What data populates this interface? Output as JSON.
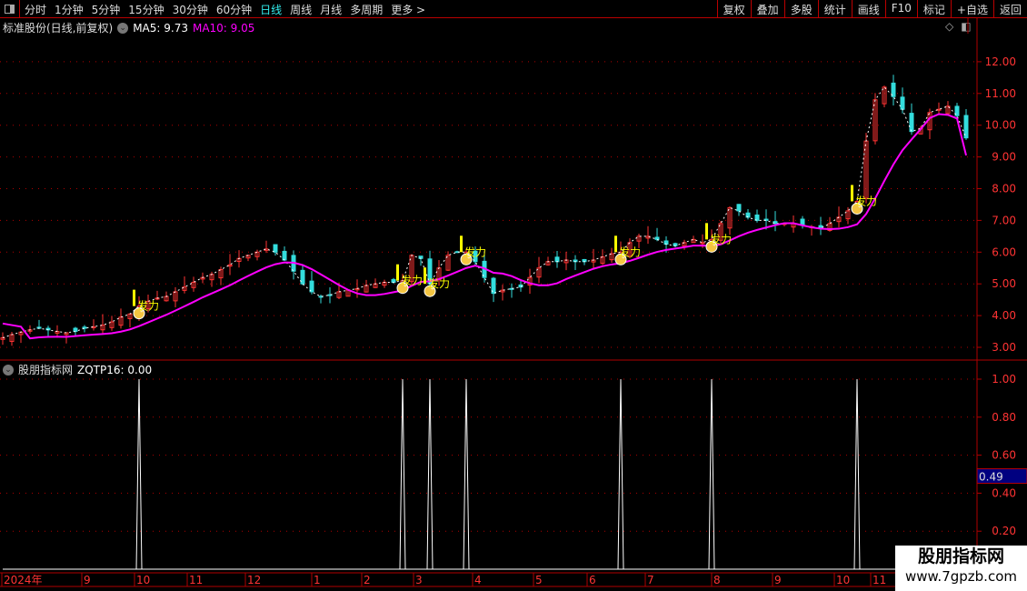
{
  "toolbar": {
    "periods": [
      "分时",
      "1分钟",
      "5分钟",
      "15分钟",
      "30分钟",
      "60分钟",
      "日线",
      "周线",
      "月线",
      "多周期",
      "更多 >"
    ],
    "active_period": "日线",
    "tools": [
      "复权",
      "叠加",
      "多股",
      "统计",
      "画线",
      "F10",
      "标记",
      "+自选",
      "返回"
    ]
  },
  "main_panel": {
    "title": "标准股份(日线,前复权)",
    "ma5_label": "MA5: 9.73",
    "ma10_label": "MA10: 9.05",
    "signal_text": "发力",
    "colors": {
      "up": "#ff3333",
      "down": "#33dddd",
      "ma10": "#ff00ff",
      "signal": "#ffff00",
      "grid": "#b00000"
    }
  },
  "indicator_panel": {
    "title": "股朋指标网",
    "value_label": "ZQTP16: 0.00",
    "cursor_value": "0.49"
  },
  "chart_data": [
    {
      "type": "candlestick",
      "ylim": [
        2.7,
        12.9
      ],
      "y_ticks": [
        "3.00",
        "4.00",
        "5.00",
        "6.00",
        "7.00",
        "8.00",
        "9.00",
        "10.00",
        "11.00",
        "12.00"
      ],
      "x_ticks": [
        "2024年",
        "9",
        "10",
        "11",
        "12",
        "1",
        "2",
        "3",
        "4",
        "5",
        "6",
        "7",
        "8",
        "9",
        "10",
        "11"
      ],
      "closes": [
        3.3,
        3.4,
        3.48,
        3.55,
        3.6,
        3.55,
        3.5,
        3.46,
        3.5,
        3.6,
        3.65,
        3.7,
        3.8,
        3.95,
        4.05,
        4.3,
        4.45,
        4.55,
        4.6,
        4.75,
        4.9,
        5.05,
        5.2,
        5.3,
        5.45,
        5.6,
        5.8,
        5.9,
        6.0,
        6.1,
        6.0,
        5.75,
        5.4,
        5.0,
        4.75,
        4.6,
        4.65,
        4.75,
        4.8,
        4.85,
        4.95,
        5.0,
        5.05,
        5.05,
        5.1,
        5.9,
        5.8,
        5.0,
        5.5,
        5.9,
        6.0,
        6.0,
        5.7,
        5.2,
        4.7,
        4.8,
        4.85,
        4.9,
        5.2,
        5.5,
        5.7,
        5.7,
        5.75,
        5.7,
        5.7,
        5.75,
        5.85,
        5.95,
        6.0,
        6.3,
        6.5,
        6.5,
        6.4,
        6.25,
        6.2,
        6.3,
        6.4,
        6.3,
        6.4,
        6.9,
        7.4,
        7.3,
        7.1,
        7.0,
        7.0,
        6.9,
        6.9,
        6.9,
        6.85,
        6.8,
        6.75,
        6.9,
        7.1,
        7.3,
        7.6,
        9.5,
        10.8,
        11.2,
        10.9,
        10.5,
        9.8,
        9.9,
        10.4,
        10.5,
        10.6,
        10.3,
        9.6
      ],
      "ma10_last": 9.05,
      "signal_bars": [
        15,
        44,
        47,
        51,
        68,
        78,
        94
      ]
    },
    {
      "type": "line",
      "name": "ZQTP16",
      "ylim": [
        0,
        1.05
      ],
      "y_ticks": [
        "0.20",
        "0.40",
        "0.60",
        "0.80",
        "1.00"
      ],
      "spike_bars": [
        15,
        44,
        47,
        51,
        68,
        78,
        94
      ],
      "spike_value": 1.0
    }
  ],
  "watermark": {
    "name": "股朋指标网",
    "url": "www.7gpzb.com"
  }
}
